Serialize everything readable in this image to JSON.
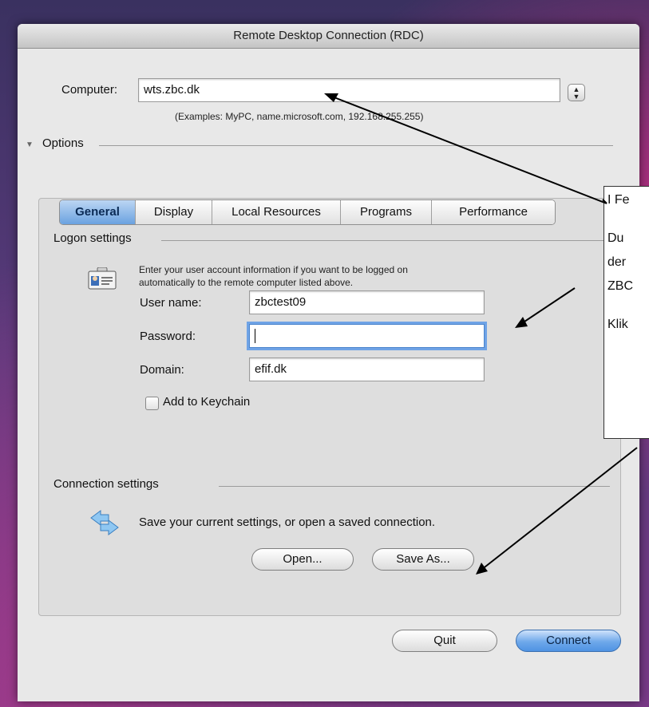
{
  "window": {
    "title": "Remote Desktop Connection (RDC)"
  },
  "computer": {
    "label": "Computer:",
    "value": "wts.zbc.dk",
    "examples": "(Examples: MyPC, name.microsoft.com, 192.168.255.255)"
  },
  "options": {
    "label": "Options"
  },
  "tabs": [
    {
      "label": "General",
      "active": true
    },
    {
      "label": "Display"
    },
    {
      "label": "Local Resources"
    },
    {
      "label": "Programs"
    },
    {
      "label": "Performance"
    }
  ],
  "logon": {
    "heading": "Logon settings",
    "info_line1": "Enter your user account information if you want to be logged on",
    "info_line2": "automatically to the remote computer listed above.",
    "username_label": "User name:",
    "username_value": "zbctest09",
    "password_label": "Password:",
    "password_value": "",
    "domain_label": "Domain:",
    "domain_value": "efif.dk",
    "keychain_label": "Add to Keychain"
  },
  "connection": {
    "heading": "Connection settings",
    "info": "Save your current settings, or open a saved connection.",
    "open_label": "Open...",
    "save_as_label": "Save As..."
  },
  "footer": {
    "quit_label": "Quit",
    "connect_label": "Connect"
  },
  "callout": {
    "line1": "I Fe",
    "line2": "Du",
    "line3": "der",
    "line4": "ZBC",
    "line5": "Klik"
  },
  "colors": {
    "accent": "#5b9be6",
    "focus_ring": "#6fa3e6"
  }
}
